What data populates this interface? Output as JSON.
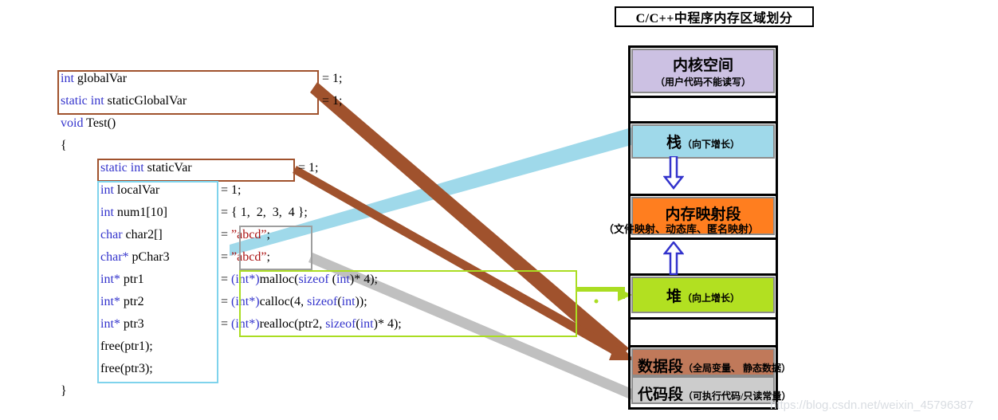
{
  "title": "C/C++中程序内存区域划分",
  "watermark": "https://blog.csdn.net/weixin_45796387",
  "code": {
    "lines": [
      {
        "indent": 0,
        "segments": [
          {
            "t": "int",
            "c": "kw"
          },
          {
            "t": " globalVar",
            "c": "plain"
          }
        ]
      },
      {
        "indent": 0,
        "segments": [
          {
            "t": "static int",
            "c": "kw"
          },
          {
            "t": " staticGlobalVar",
            "c": "plain"
          }
        ]
      },
      {
        "indent": 0,
        "segments": [
          {
            "t": "void",
            "c": "kw"
          },
          {
            "t": " Test()",
            "c": "plain"
          }
        ]
      },
      {
        "indent": 0,
        "segments": [
          {
            "t": "{",
            "c": "plain"
          }
        ]
      },
      {
        "indent": 1,
        "segments": [
          {
            "t": "static int",
            "c": "kw"
          },
          {
            "t": " staticVar",
            "c": "plain"
          }
        ]
      },
      {
        "indent": 1,
        "segments": [
          {
            "t": "int",
            "c": "kw"
          },
          {
            "t": " localVar",
            "c": "plain"
          }
        ]
      },
      {
        "indent": 1,
        "segments": [
          {
            "t": "int",
            "c": "kw"
          },
          {
            "t": " num1[10]",
            "c": "plain"
          }
        ]
      },
      {
        "indent": 1,
        "segments": [
          {
            "t": "char",
            "c": "kw"
          },
          {
            "t": " char2[]",
            "c": "plain"
          }
        ]
      },
      {
        "indent": 1,
        "segments": [
          {
            "t": "char*",
            "c": "kw"
          },
          {
            "t": " pChar3",
            "c": "plain"
          }
        ]
      },
      {
        "indent": 1,
        "segments": [
          {
            "t": "int*",
            "c": "kw"
          },
          {
            "t": " ptr1",
            "c": "plain"
          }
        ]
      },
      {
        "indent": 1,
        "segments": [
          {
            "t": "int*",
            "c": "kw"
          },
          {
            "t": " ptr2",
            "c": "plain"
          }
        ]
      },
      {
        "indent": 1,
        "segments": [
          {
            "t": "int*",
            "c": "kw"
          },
          {
            "t": " ptr3",
            "c": "plain"
          }
        ]
      },
      {
        "indent": 1,
        "segments": [
          {
            "t": "free(ptr1);",
            "c": "plain"
          }
        ]
      },
      {
        "indent": 1,
        "segments": [
          {
            "t": "free(ptr3);",
            "c": "plain"
          }
        ]
      },
      {
        "indent": 0,
        "segments": [
          {
            "t": "}",
            "c": "plain"
          }
        ]
      }
    ],
    "rhs": [
      {
        "line": 0,
        "segments": [
          {
            "t": "= 1;",
            "c": "plain"
          }
        ]
      },
      {
        "line": 1,
        "segments": [
          {
            "t": "= 1;",
            "c": "plain"
          }
        ]
      },
      {
        "line": 4,
        "segments": [
          {
            "t": "= 1;",
            "c": "plain"
          }
        ]
      },
      {
        "line": 5,
        "segments": [
          {
            "t": "= 1;",
            "c": "plain"
          }
        ]
      },
      {
        "line": 6,
        "segments": [
          {
            "t": "= { 1,  2,  3,  4 };",
            "c": "plain"
          }
        ]
      },
      {
        "line": 7,
        "segments": [
          {
            "t": "= ",
            "c": "plain"
          },
          {
            "t": "“abcd”",
            "c": "str"
          },
          {
            "t": ";",
            "c": "plain"
          }
        ]
      },
      {
        "line": 8,
        "segments": [
          {
            "t": "= ",
            "c": "plain"
          },
          {
            "t": "“abcd”",
            "c": "str"
          },
          {
            "t": ";",
            "c": "plain"
          }
        ]
      },
      {
        "line": 9,
        "segments": [
          {
            "t": "= ",
            "c": "plain"
          },
          {
            "t": "(int*)",
            "c": "kw"
          },
          {
            "t": "malloc(",
            "c": "plain"
          },
          {
            "t": "sizeof",
            "c": "kw"
          },
          {
            "t": " (",
            "c": "plain"
          },
          {
            "t": "int",
            "c": "kw"
          },
          {
            "t": ")* 4);",
            "c": "plain"
          }
        ]
      },
      {
        "line": 10,
        "segments": [
          {
            "t": "= ",
            "c": "plain"
          },
          {
            "t": "(int*)",
            "c": "kw"
          },
          {
            "t": "calloc(4, ",
            "c": "plain"
          },
          {
            "t": "sizeof",
            "c": "kw"
          },
          {
            "t": "(",
            "c": "plain"
          },
          {
            "t": "int",
            "c": "kw"
          },
          {
            "t": "));",
            "c": "plain"
          }
        ]
      },
      {
        "line": 11,
        "segments": [
          {
            "t": "= ",
            "c": "plain"
          },
          {
            "t": "(int*)",
            "c": "kw"
          },
          {
            "t": "realloc(ptr2, ",
            "c": "plain"
          },
          {
            "t": "sizeof",
            "c": "kw"
          },
          {
            "t": "(",
            "c": "plain"
          },
          {
            "t": "int",
            "c": "kw"
          },
          {
            "t": ")* 4);",
            "c": "plain"
          }
        ]
      }
    ]
  },
  "memory": {
    "segments": [
      {
        "name": "kernel-space",
        "main": "内核空间",
        "sub": "（用户代码不能读写）",
        "sub_pos": "below",
        "color": "#ccc1e3"
      },
      {
        "name": "stack",
        "main": "栈",
        "sub": "（向下增长）",
        "sub_pos": "inline",
        "color": "#9fd9ea"
      },
      {
        "name": "memory-mapping",
        "main": "内存映射段",
        "sub": "（文件映射、动态库、匿名映射）",
        "sub_pos": "overflow",
        "color": "#ff7e1f"
      },
      {
        "name": "heap",
        "main": "堆",
        "sub": "（向上增长）",
        "sub_pos": "inline",
        "color": "#b2e021"
      },
      {
        "name": "data-segment",
        "main": "数据段",
        "sub": "（全局变量、 静态数据）",
        "sub_pos": "overflow-inline",
        "color": "#c0795a"
      },
      {
        "name": "code-segment",
        "main": "代码段",
        "sub": "（可执行代码/只读常量）",
        "sub_pos": "overflow-inline",
        "color": "#cccccc"
      }
    ],
    "arrows": [
      {
        "name": "stack-grows-down",
        "direction": "down"
      },
      {
        "name": "heap-grows-up",
        "direction": "up"
      }
    ]
  },
  "connectors": [
    {
      "name": "global-static-to-data-segment",
      "color": "#a0522d"
    },
    {
      "name": "static-var-to-data-segment",
      "color": "#a0522d"
    },
    {
      "name": "locals-to-stack",
      "color": "#9fd9ea"
    },
    {
      "name": "string-literal-to-code-segment",
      "color": "#c0c0c0"
    },
    {
      "name": "malloc-block-to-heap",
      "color": "#aadd22"
    }
  ],
  "colors": {
    "kernel": "#ccc1e3",
    "stack": "#9fd9ea",
    "mmap": "#ff7e1f",
    "heap": "#b2e021",
    "data": "#c0795a",
    "code": "#cccccc",
    "keyword": "#3333cc",
    "string": "#aa1111",
    "border_brown": "#a0522d",
    "border_cyan": "#7fd3ec",
    "border_gray": "#9e9e9e",
    "border_green": "#aadd22",
    "arrow_blue": "#3333cc"
  }
}
